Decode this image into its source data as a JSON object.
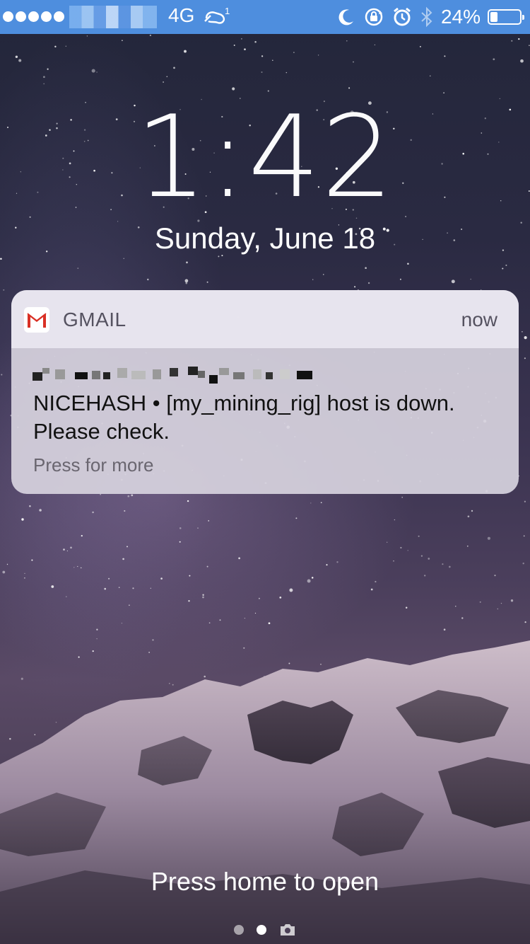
{
  "status_bar": {
    "network": "4G",
    "data_badge": "1",
    "battery_percent_label": "24%",
    "battery_level": 0.24,
    "icons": [
      "signal-dots-icon",
      "cellular-data-icon",
      "moon-icon",
      "rotation-lock-icon",
      "alarm-icon",
      "bluetooth-icon",
      "battery-icon"
    ],
    "accent_color": "#4e8ede"
  },
  "lock_screen": {
    "time": "1:42",
    "date": "Sunday, June 18"
  },
  "notification": {
    "app_name": "GMAIL",
    "app_icon": "gmail-icon",
    "time": "now",
    "body": "NICEHASH  •  [my_mining_rig] host is down. Please check.",
    "more": "Press for more"
  },
  "footer": {
    "unlock_hint": "Press home to open",
    "pages_active_index": 1,
    "page_icons": [
      "page-dot-icon",
      "page-dot-icon",
      "camera-icon"
    ]
  }
}
